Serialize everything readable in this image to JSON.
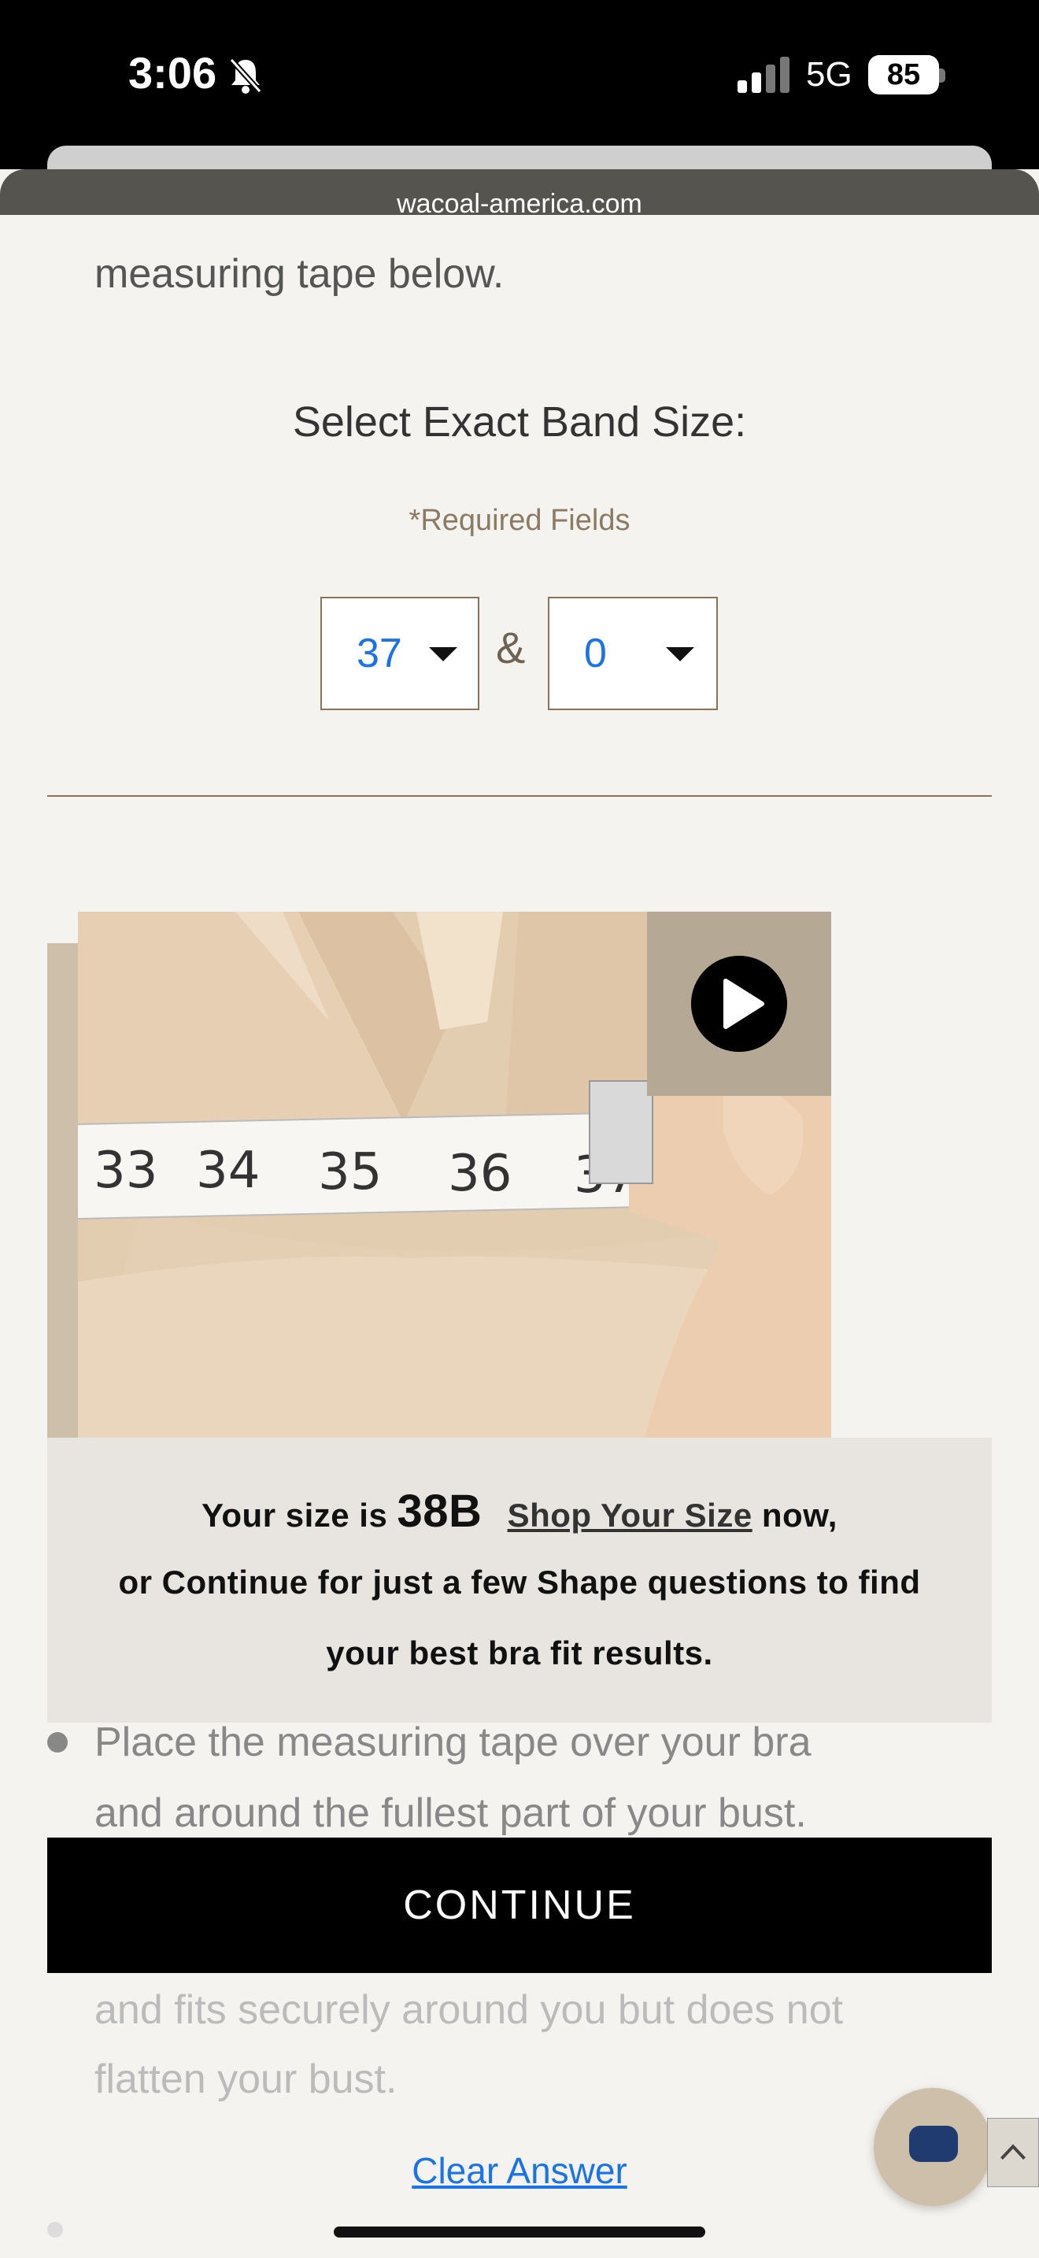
{
  "status_bar": {
    "time": "3:06",
    "network": "5G",
    "battery": "85",
    "icons": [
      "bell-slash-icon",
      "signal-icon"
    ]
  },
  "browser": {
    "url": "wacoal-america.com"
  },
  "content": {
    "partial_top_line": "measuring tape below.",
    "heading": "Select Exact Band Size:",
    "required": "*Required Fields",
    "band_select": {
      "value": "37"
    },
    "fraction_select": {
      "value": "0"
    },
    "ampersand": "&"
  },
  "result_panel": {
    "prefix": "Your size is",
    "size": "38B",
    "shop_link": "Shop Your Size",
    "suffix": "now,",
    "line2": "or Continue for just a few Shape questions to find",
    "line3": "your best bra fit results."
  },
  "instructions": {
    "bullet_line1": "Place the measuring tape over your bra",
    "bullet_line2": "and around the fullest part of your bust.",
    "faded_line1": "and fits securely around you but does not",
    "faded_line2": "flatten your bust."
  },
  "continue_button": "CONTINUE",
  "clear_answer": "Clear Answer",
  "colors": {
    "accent": "#1a73e8",
    "brand_tan": "#8b7355",
    "panel": "#e8e5e0",
    "button": "#000000"
  }
}
